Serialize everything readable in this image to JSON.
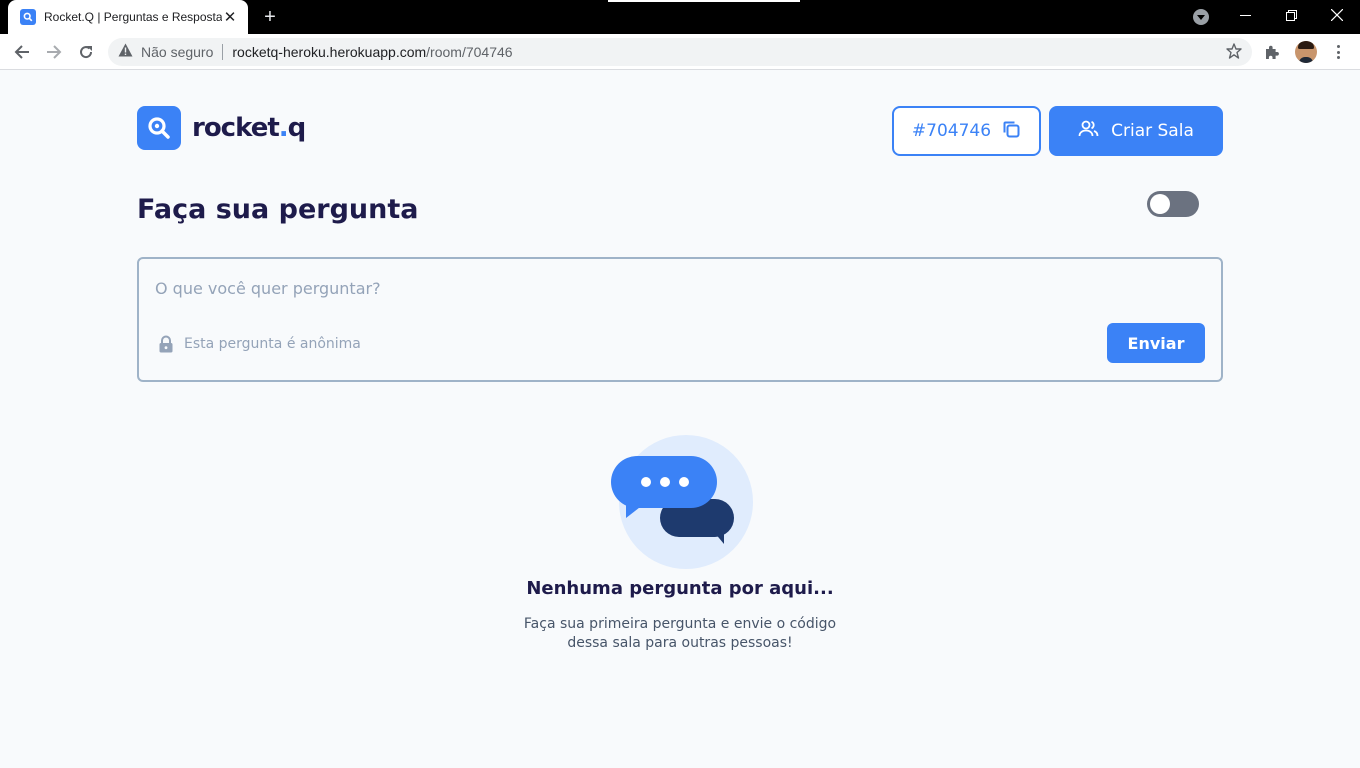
{
  "browser": {
    "tab_title": "Rocket.Q | Perguntas e Respostas",
    "tab_close": "✕",
    "new_tab": "+",
    "insecure_label": "Não seguro",
    "url_host": "rocketq-heroku.herokuapp.com",
    "url_path": "/room/704746"
  },
  "header": {
    "logo_text": "rocket",
    "logo_dot": ".",
    "logo_suffix": "q",
    "room_code": "#704746",
    "create_room_label": "Criar Sala"
  },
  "main": {
    "title": "Faça sua pergunta",
    "question_placeholder": "O que você quer perguntar?",
    "anonymous_label": "Esta pergunta é anônima",
    "send_label": "Enviar"
  },
  "empty_state": {
    "title": "Nenhuma pergunta por aqui...",
    "text": "Faça sua primeira pergunta e envie o código dessa sala para outras pessoas!"
  },
  "icons": {
    "tab_favicon": "search-icon",
    "copy": "copy-icon",
    "users": "users-icon",
    "lock": "lock-icon",
    "chat": "chat-bubbles-icon"
  },
  "colors": {
    "accent": "#3b82f6",
    "heading": "#1e1b4b",
    "toggle_off": "#6b7280",
    "bubble_dark": "#1e3a6e"
  },
  "toggle": {
    "on": false
  }
}
